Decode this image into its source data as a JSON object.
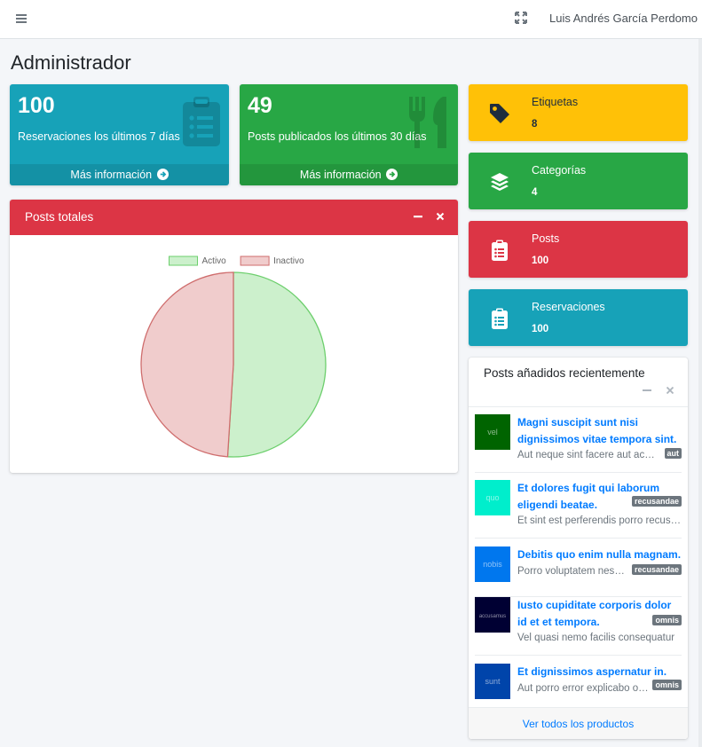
{
  "navbar": {
    "menu_icon": "bars-icon",
    "fullscreen_icon": "expand-icon",
    "user_name": "Luis Andrés García Perdomo"
  },
  "page_title": "Administrador",
  "stat_boxes": [
    {
      "value": "100",
      "label": "Reservaciones los últimos 7 días",
      "link": "Más información",
      "color": "#17a2b8",
      "icon": "clipboard-list-icon"
    },
    {
      "value": "49",
      "label": "Posts publicados los últimos 30 días",
      "link": "Más información",
      "color": "#28a745",
      "icon": "utensils-icon"
    }
  ],
  "posts_card": {
    "title": "Posts totales",
    "chart_data": {
      "type": "pie",
      "labels": [
        "Activo",
        "Inactivo"
      ],
      "values": [
        51,
        49
      ],
      "colors": [
        "#ccf0cc",
        "#f0cccc"
      ],
      "border_colors": [
        "#6dcf6d",
        "#cf6d6d"
      ],
      "legend": "top"
    }
  },
  "info_boxes": [
    {
      "label": "Etiquetas",
      "value": "8",
      "color": "#ffc107",
      "icon": "tag-icon"
    },
    {
      "label": "Categorías",
      "value": "4",
      "color": "#28a745",
      "icon": "layers-icon"
    },
    {
      "label": "Posts",
      "value": "100",
      "color": "#dc3545",
      "icon": "clipboard-icon"
    },
    {
      "label": "Reservaciones",
      "value": "100",
      "color": "#17a2b8",
      "icon": "clipboard-icon"
    }
  ],
  "recent": {
    "title": "Posts añadidos recientemente",
    "footer": "Ver todos los productos",
    "items": [
      {
        "title": "Magni suscipit sunt nisi dignissimos vitae tempora sint.",
        "desc": "Aut neque sint facere aut accusamus",
        "badge": "aut",
        "thumb_color": "#006400",
        "thumb_text": "vel"
      },
      {
        "title": "Et dolores fugit qui laborum eligendi beatae.",
        "desc": "Et sint est perferendis porro recusandae",
        "badge": "recusandae",
        "thumb_color": "#00eecc",
        "thumb_text": "quo"
      },
      {
        "title": "Debitis quo enim nulla magnam.",
        "desc": "Porro voluptatem nesciunt",
        "badge": "recusandae",
        "thumb_color": "#0077ee",
        "thumb_text": "nobis"
      },
      {
        "title": "Iusto cupiditate corporis dolor id et et tempora.",
        "desc": "Vel quasi nemo facilis consequatur",
        "badge": "omnis",
        "thumb_color": "#000033",
        "thumb_text": "accusamus"
      },
      {
        "title": "Et dignissimos aspernatur in.",
        "desc": "Aut porro error explicabo omnis",
        "badge": "omnis",
        "thumb_color": "#0044aa",
        "thumb_text": "sunt"
      }
    ]
  }
}
